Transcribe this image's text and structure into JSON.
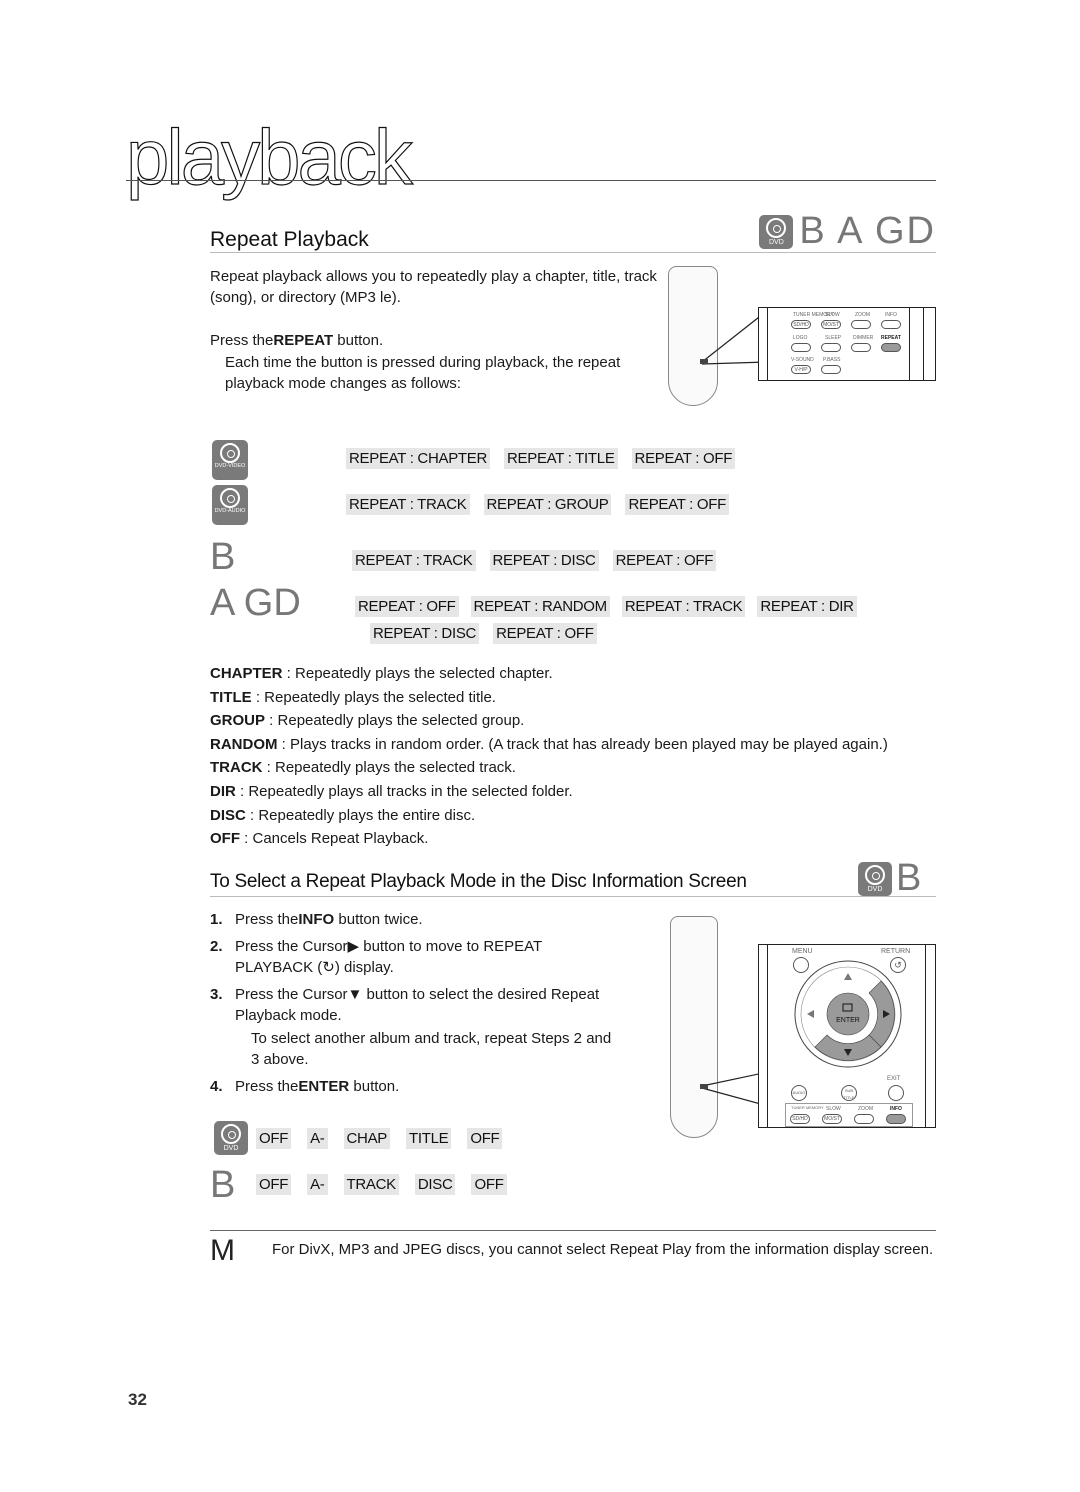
{
  "header": {
    "chapter_title": "playback",
    "section_title": "Repeat Playback",
    "section_disc_icon": "dvd-icon",
    "section_disc_icon_label": "DVD",
    "section_disc_letters": "B A GD"
  },
  "intro": {
    "text": "Repeat playback allows you to repeatedly play a chapter, title, track (song), or directory (MP3  le).",
    "press_prefix": "Press the",
    "press_button": "REPEAT",
    "press_suffix": " button.",
    "note": "Each time the button is pressed during playback, the repeat playback mode changes as follows:"
  },
  "remote_top": {
    "buttons": [
      {
        "top_label": "TUNER MEMORY",
        "label": "SD/HD"
      },
      {
        "top_label": "SLOW",
        "label": "MO/ST"
      },
      {
        "top_label": "ZOOM",
        "label": ""
      },
      {
        "top_label": "INFO",
        "label": ""
      },
      {
        "top_label": "LOGO",
        "label": ""
      },
      {
        "top_label": "SLEEP",
        "label": ""
      },
      {
        "top_label": "DIMMER",
        "label": ""
      },
      {
        "top_label": "REPEAT",
        "label": ""
      },
      {
        "top_label": "V-SOUND",
        "label": "V-H/P"
      },
      {
        "top_label": "P.BASS",
        "label": ""
      }
    ],
    "highlighted": "REPEAT"
  },
  "modes": {
    "dvd_video": {
      "icon_label": "DVD-VIDEO",
      "items": [
        "REPEAT : CHAPTER",
        "REPEAT : TITLE",
        "REPEAT : OFF"
      ]
    },
    "dvd_audio": {
      "icon_label": "DVD-AUDIO",
      "items": [
        "REPEAT : TRACK",
        "REPEAT : GROUP",
        "REPEAT : OFF"
      ]
    },
    "b": {
      "letter": "B",
      "items": [
        "REPEAT : TRACK",
        "REPEAT : DISC",
        "REPEAT : OFF"
      ]
    },
    "agd": {
      "letter": "A GD",
      "items_row1": [
        "REPEAT : OFF",
        "REPEAT : RANDOM",
        "REPEAT : TRACK",
        "REPEAT : DIR"
      ],
      "items_row2": [
        "REPEAT : DISC",
        "REPEAT : OFF"
      ]
    }
  },
  "definitions": [
    {
      "term": "CHAPTER",
      "desc": " : Repeatedly plays the selected chapter."
    },
    {
      "term": "TITLE",
      "desc": " : Repeatedly plays the selected title."
    },
    {
      "term": "GROUP",
      "desc": " : Repeatedly plays the selected group."
    },
    {
      "term": "RANDOM",
      "desc": " : Plays tracks in random order. (A track that has already been played may be played again.)"
    },
    {
      "term": "TRACK",
      "desc": " : Repeatedly plays the selected track."
    },
    {
      "term": "DIR",
      "desc": " : Repeatedly plays all tracks in the selected folder."
    },
    {
      "term": "DISC",
      "desc": " : Repeatedly plays the entire disc."
    },
    {
      "term": "OFF",
      "desc": " : Cancels Repeat Playback."
    }
  ],
  "subsection": {
    "title": "To Select a Repeat Playback Mode in the Disc Information Screen",
    "disc_icon_label": "DVD",
    "disc_letter": "B"
  },
  "steps": [
    {
      "num": "1.",
      "prefix": "Press the",
      "bold": "INFO",
      "suffix": " button twice."
    },
    {
      "num": "2.",
      "line1": "Press the Cursor▶ button to move to REPEAT",
      "line2": "PLAYBACK (↻) display."
    },
    {
      "num": "3.",
      "line1": "Press the Cursor▼ button to select the desired Repeat",
      "line2": "Playback mode."
    },
    {
      "num": "",
      "line1": "To select another album and track, repeat Steps 2 and",
      "line2": "3 above."
    },
    {
      "num": "4.",
      "prefix": "Press the",
      "bold": "ENTER",
      "suffix": " button."
    }
  ],
  "remote_bottom": {
    "menu": "MENU",
    "return": "RETURN",
    "enter": "ENTER",
    "exit": "EXIT",
    "audio": "AUDIO",
    "subtitle": "SUB TITLE",
    "row_labels": [
      "TUNER MEMORY",
      "SLOW",
      "ZOOM",
      "INFO"
    ],
    "row_buttons": [
      "SD/HD",
      "MO/ST",
      "",
      ""
    ],
    "highlighted": "INFO"
  },
  "info_modes": {
    "dvd": {
      "icon_label": "DVD",
      "items": [
        "OFF",
        "A-",
        "CHAP",
        "TITLE",
        "OFF"
      ]
    },
    "b": {
      "letter": "B",
      "items": [
        "OFF",
        "A-",
        "TRACK",
        "DISC",
        "OFF"
      ]
    }
  },
  "note": {
    "marker": "M",
    "text": "For DivX, MP3 and JPEG discs, you cannot select Repeat Play from the information display screen."
  },
  "page_number": "32"
}
